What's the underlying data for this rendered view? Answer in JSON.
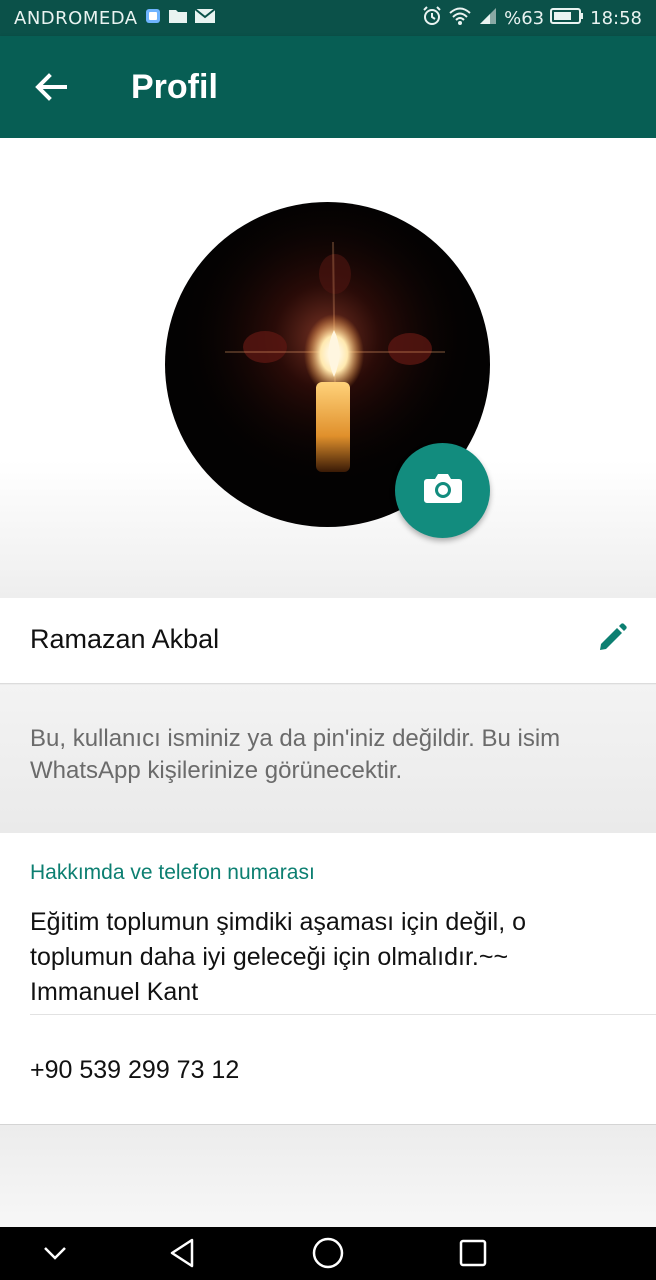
{
  "status_bar": {
    "carrier": "ANDROMEDA",
    "battery_percent": "%63",
    "time": "18:58",
    "icons": [
      "notification-square-icon",
      "folder-icon",
      "mail-icon",
      "alarm-icon",
      "wifi-icon",
      "signal-icon",
      "battery-icon"
    ]
  },
  "app_bar": {
    "title": "Profil",
    "back_icon": "arrow-left-icon"
  },
  "avatar": {
    "image": "candle-photo",
    "camera_icon": "camera-icon",
    "accent_color": "#128c7e"
  },
  "profile": {
    "name": "Ramazan Akbal",
    "edit_icon": "pencil-icon",
    "name_hint": "Bu, kullanıcı isminiz ya da pin'iniz değildir. Bu isim WhatsApp kişilerinize görünecektir."
  },
  "about": {
    "header": "Hakkımda ve telefon numarası",
    "text": "Eğitim toplumun şimdiki aşaması için değil, o toplumun daha iyi geleceği için olmalıdır.~~ Immanuel Kant",
    "phone": "+90 539 299 73 12"
  },
  "nav_bar": {
    "buttons": [
      "chevron-down-icon",
      "back-triangle-icon",
      "home-circle-icon",
      "recents-square-icon"
    ]
  },
  "colors": {
    "app_bar": "#075e54",
    "status_bar": "#0b5149",
    "accent_text": "#0c7f71"
  }
}
